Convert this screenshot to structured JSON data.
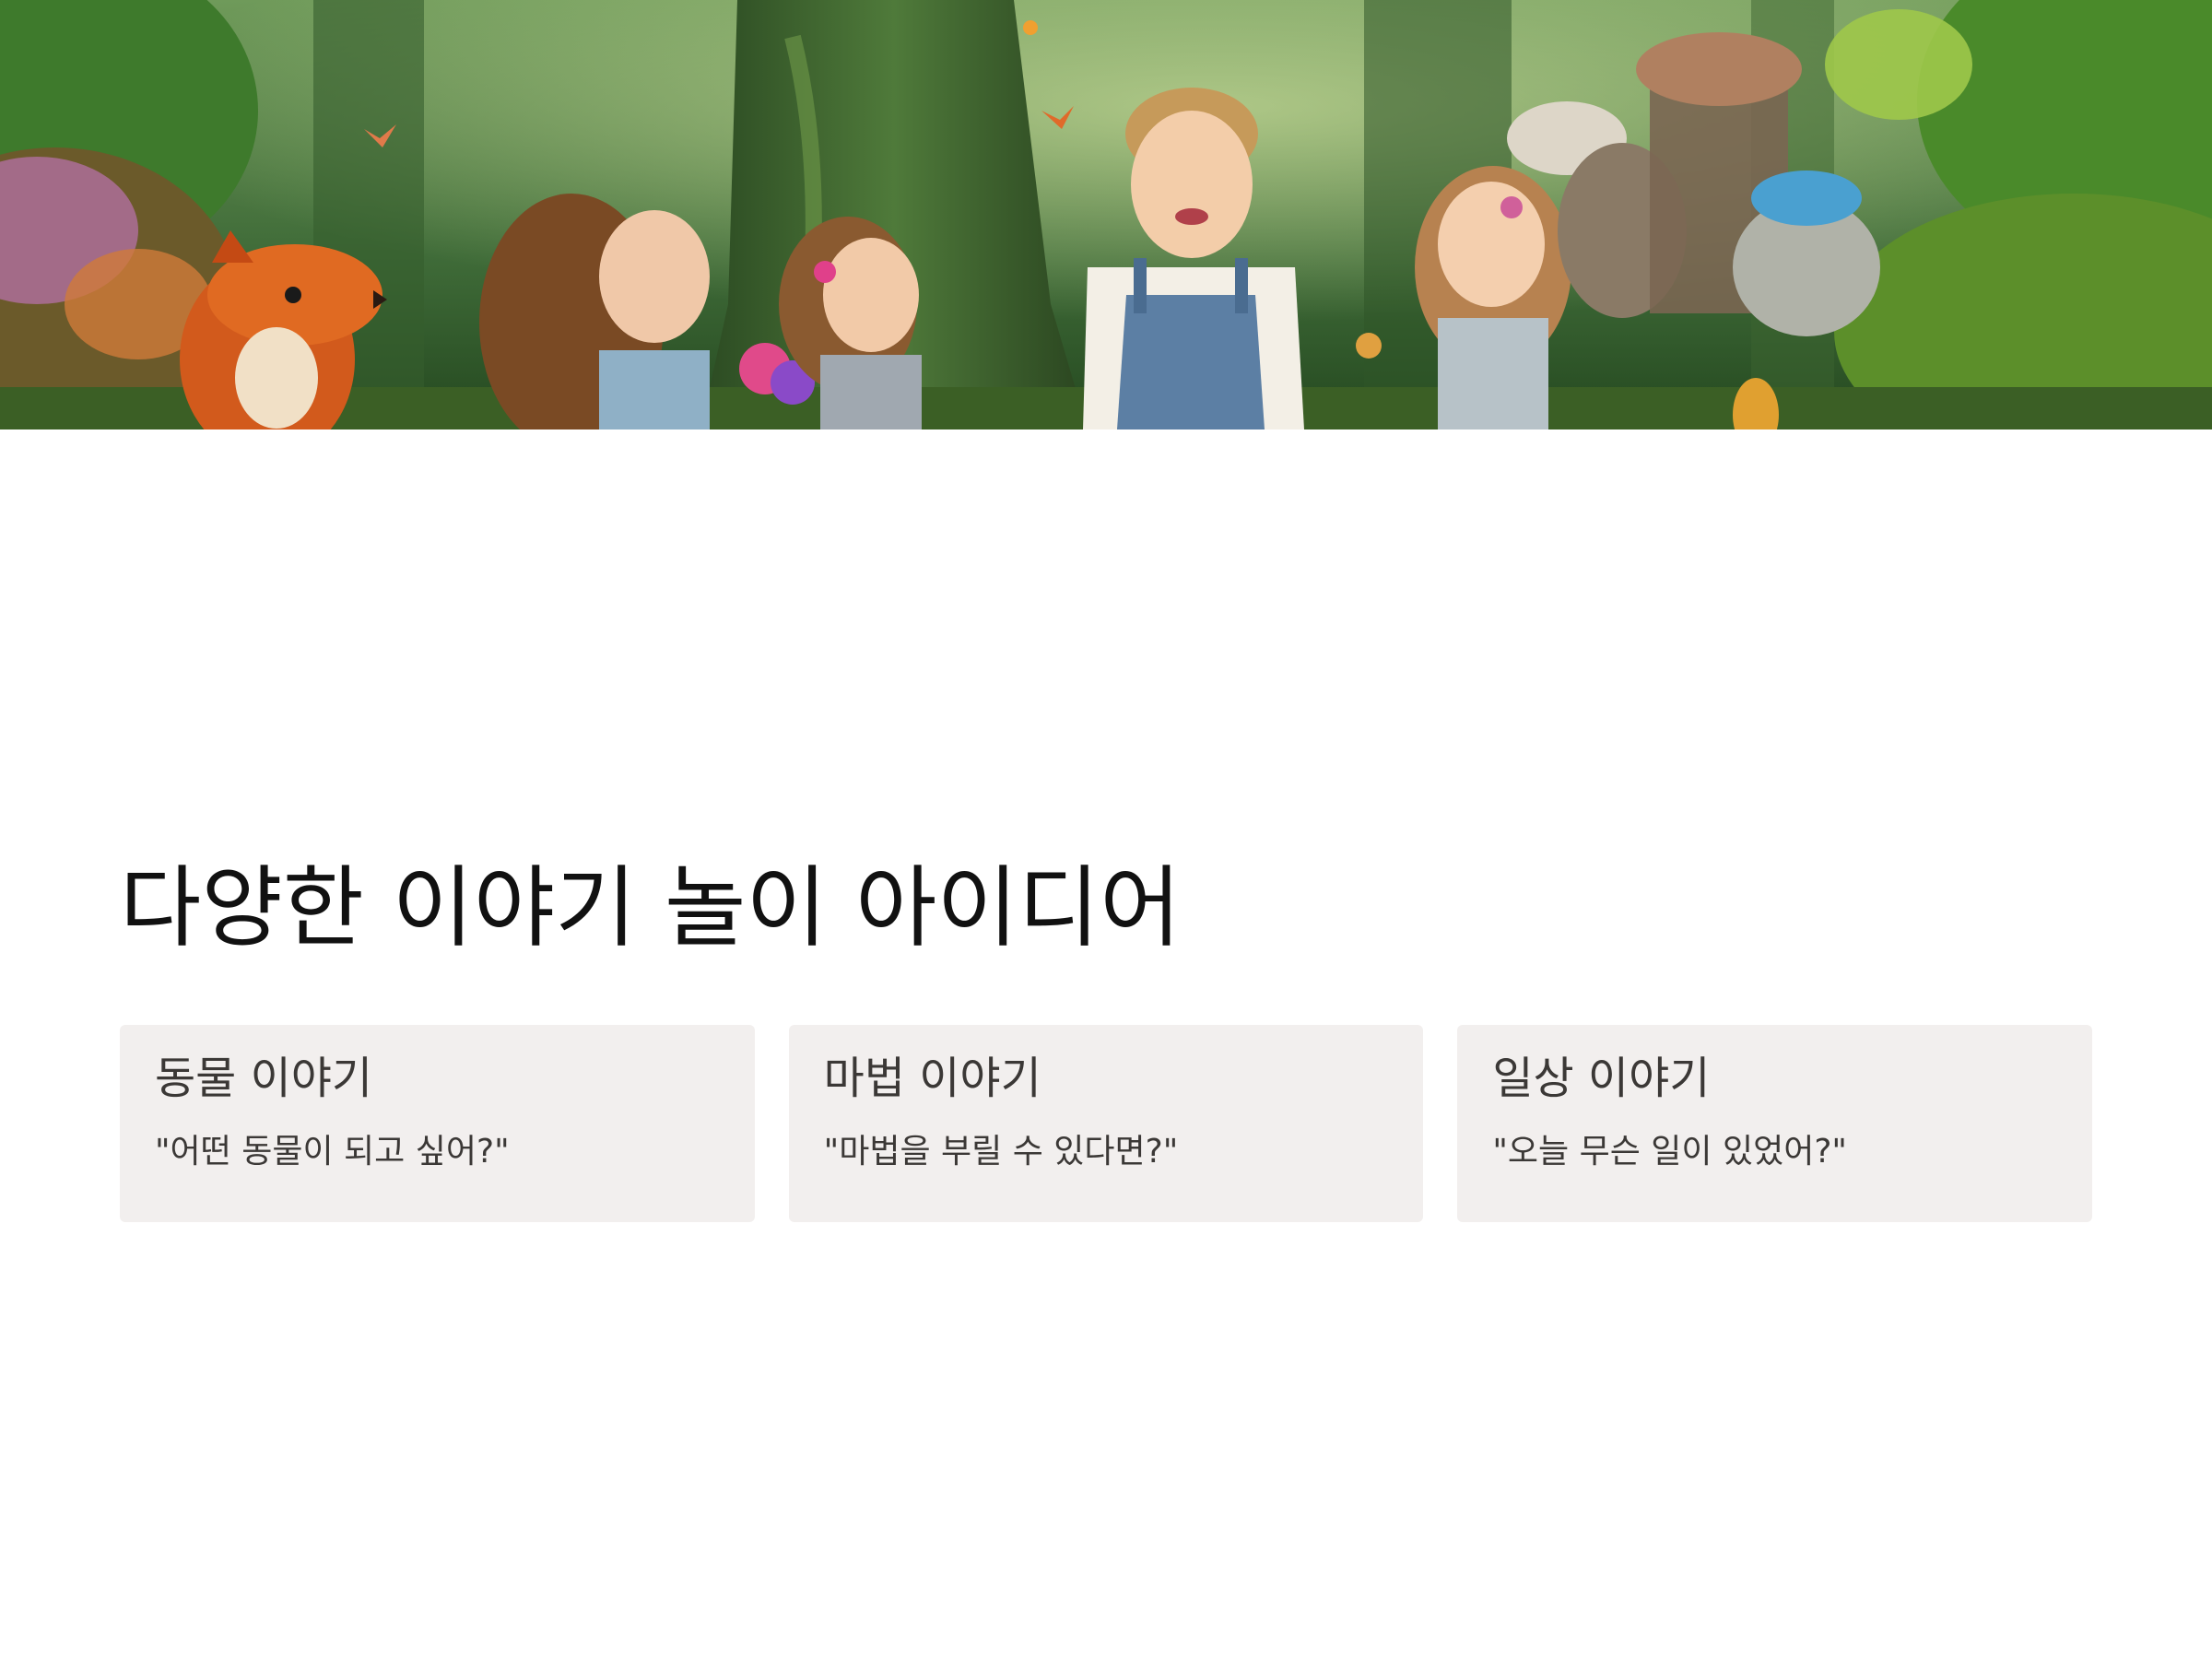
{
  "hero": {
    "image_name": "forest-children-storytelling-illustration"
  },
  "main": {
    "title": "다양한 이야기 놀이 아이디어"
  },
  "cards": [
    {
      "title": "동물 이야기",
      "prompt": "\"어떤 동물이 되고 싶어?\""
    },
    {
      "title": "마법 이야기",
      "prompt": "\"마법을 부릴 수 있다면?\""
    },
    {
      "title": "일상 이야기",
      "prompt": "\"오늘 무슨 일이 있었어?\""
    }
  ],
  "colors": {
    "background": "#ffffff",
    "card_background": "#f2efee",
    "title_text": "#111111",
    "card_text": "#3b3836"
  }
}
